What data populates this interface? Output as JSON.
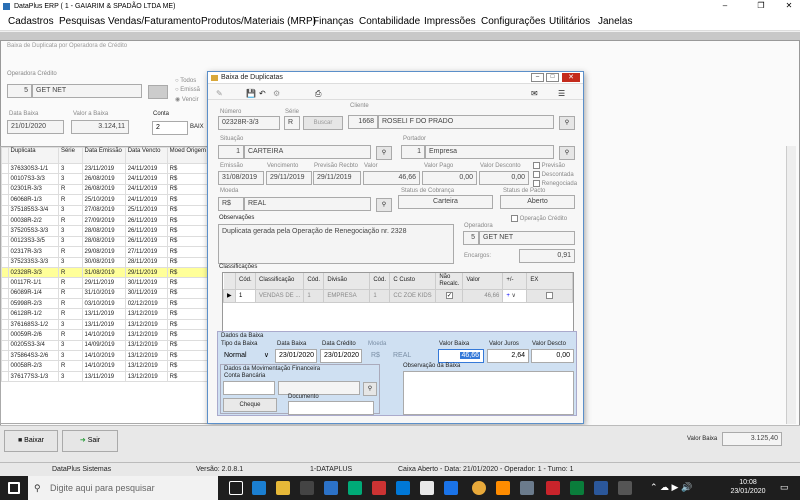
{
  "app": {
    "title": "DataPlus ERP ( 1 - GAIARIM & SPADÃO LTDA ME)"
  },
  "menu": [
    "Cadastros",
    "Pesquisas",
    "Vendas/Faturamento",
    "Produtos/Materiais (MRP)",
    "Finanças",
    "Contabilidade",
    "Impressões",
    "Configurações",
    "Utilitários",
    "Janelas"
  ],
  "bg": {
    "title": "Baixa de Duplicata por Operadora de Crédito",
    "operadora_label": "Operadora Crédito",
    "operadora_code": "5",
    "operadora_name": "GET NET",
    "radio_todos": "Todos",
    "radio_emiss": "Emissã",
    "radio_venci": "Vencir",
    "data_baixa_label": "Data Baixa",
    "data_baixa": "21/01/2020",
    "valor_baixa_label": "Valor a Baixa",
    "valor_baixa": "3.124,11",
    "conta_label": "Conta",
    "conta_value": "2",
    "baix_label": "BAIX",
    "grid_headers": [
      "Duplicata",
      "Série",
      "Data Emissão",
      "Data Vencto",
      "Moed Origem"
    ],
    "rows": [
      [
        "376330S3-1/1",
        "3",
        "23/11/2019",
        "24/11/2019",
        "R$"
      ],
      [
        "00107S3-3/3",
        "3",
        "26/08/2019",
        "24/11/2019",
        "R$"
      ],
      [
        "02301R-3/3",
        "R",
        "26/08/2019",
        "24/11/2019",
        "R$"
      ],
      [
        "06068R-1/3",
        "R",
        "25/10/2019",
        "24/11/2019",
        "R$"
      ],
      [
        "375185S3-3/4",
        "3",
        "27/08/2019",
        "25/11/2019",
        "R$"
      ],
      [
        "00038R-2/2",
        "R",
        "27/09/2019",
        "26/11/2019",
        "R$"
      ],
      [
        "375205S3-3/3",
        "3",
        "28/08/2019",
        "26/11/2019",
        "R$"
      ],
      [
        "00123S3-3/5",
        "3",
        "28/08/2019",
        "26/11/2019",
        "R$"
      ],
      [
        "02317R-3/3",
        "R",
        "29/08/2019",
        "27/11/2019",
        "R$"
      ],
      [
        "375233S3-3/3",
        "3",
        "30/08/2019",
        "28/11/2019",
        "R$"
      ],
      [
        "02328R-3/3",
        "R",
        "31/08/2019",
        "29/11/2019",
        "R$"
      ],
      [
        "00117R-1/1",
        "R",
        "29/11/2019",
        "30/11/2019",
        "R$"
      ],
      [
        "06089R-1/4",
        "R",
        "31/10/2019",
        "30/11/2019",
        "R$"
      ],
      [
        "05998R-2/3",
        "R",
        "03/10/2019",
        "02/12/2019",
        "R$"
      ],
      [
        "06128R-1/2",
        "R",
        "13/11/2019",
        "13/12/2019",
        "R$"
      ],
      [
        "376168S3-1/2",
        "3",
        "13/11/2019",
        "13/12/2019",
        "R$"
      ],
      [
        "00059R-2/6",
        "R",
        "14/10/2019",
        "13/12/2019",
        "R$"
      ],
      [
        "00205S3-3/4",
        "3",
        "14/09/2019",
        "13/12/2019",
        "R$"
      ],
      [
        "375864S3-2/6",
        "3",
        "14/10/2019",
        "13/12/2019",
        "R$"
      ],
      [
        "00058R-2/3",
        "R",
        "14/10/2019",
        "13/12/2019",
        "R$"
      ],
      [
        "376177S3-1/3",
        "3",
        "13/11/2019",
        "13/12/2019",
        "R$"
      ]
    ],
    "baixar_label": "Baixar",
    "sair_label": "Sair",
    "valor_baixa_bottom_label": "Valor Baixa",
    "valor_baixa_bottom": "3.125,40"
  },
  "dlg": {
    "title": "Baixa de Duplicatas",
    "numero_label": "Número",
    "numero": "02328R-3/3",
    "serie_label": "Série",
    "serie": "R",
    "buscar_label": "Buscar",
    "cliente_label": "Cliente",
    "cliente_code": "1668",
    "cliente_name": "ROSELI F DO PRADO",
    "situacao_label": "Situação",
    "situacao_code": "1",
    "situacao_name": "CARTEIRA",
    "portador_label": "Portador",
    "portador_code": "1",
    "portador_name": "Empresa",
    "emissao_label": "Emissão",
    "emissao": "31/08/2019",
    "vencimento_label": "Vencimento",
    "vencimento": "29/11/2019",
    "previsao_label": "Previsão Recbto",
    "previsao": "29/11/2019",
    "valor_label": "Valor",
    "valor": "46,66",
    "valor_pago_label": "Valor Pago",
    "valor_pago": "0,00",
    "valor_desconto_label": "Valor Desconto",
    "valor_desconto": "0,00",
    "chk_previsao": "Previsão",
    "chk_descontada": "Descontada",
    "chk_renegociada": "Renegociada",
    "moeda_label": "Moeda",
    "moeda_code": "R$",
    "moeda_name": "REAL",
    "status_cobranca_label": "Status de Cobrança",
    "status_cobranca": "Carteira",
    "status_pacto_label": "Status de Pacto",
    "status_pacto": "Aberto",
    "observacoes_label": "Observações",
    "observacoes": "Duplicata gerada pela Operação de Renegociação nr. 2328",
    "operacao_credito_label": "Operação Crédito",
    "operadora_label": "Operadora",
    "operadora_code": "5",
    "operadora_name": "GET NET",
    "encargos_label": "Encargos:",
    "encargos": "0,91",
    "classificacoes_label": "Classificações",
    "cls_headers": [
      "Cód.",
      "Classificação",
      "Cód.",
      "Divisão",
      "Cód.",
      "C Custo",
      "Não Recalc.",
      "Valor",
      "+/-",
      "EX"
    ],
    "cls_row": {
      "cod": "1",
      "classificacao": "VENDAS DE ...",
      "cod2": "1",
      "divisao": "EMPRESA",
      "cod3": "1",
      "custo": "CC ZOE KIDS",
      "valor": "46,66",
      "sinal": "+"
    },
    "dados_baixa_label": "Dados da Baixa",
    "tipo_baixa_label": "Tipo da Baixa",
    "tipo_baixa": "Normal",
    "data_baixa_label": "Data Baixa",
    "data_baixa": "23/01/2020",
    "data_credito_label": "Data Crédito",
    "data_credito": "23/01/2020",
    "moeda2_label": "Moeda",
    "moeda2_code": "R$",
    "moeda2_name": "REAL",
    "valor_baixa_label": "Valor Baixa",
    "valor_baixa": "46,66",
    "valor_juros_label": "Valor Juros",
    "valor_juros": "2,64",
    "valor_descto_label": "Valor Descto",
    "valor_descto": "0,00",
    "mov_label": "Dados da Movimentação Financeira",
    "conta_label": "Conta Bancária",
    "documento_label": "Documento",
    "cheque_label": "Cheque",
    "obs_baixa_label": "Observação da Baixa"
  },
  "status": {
    "company": "DataPlus Sistemas",
    "version": "Versão: 2.0.8.1",
    "server": "1-DATAPLUS",
    "caixa": "Caixa Aberto - Data: 21/01/2020 - Operador: 1 - Turno: 1"
  },
  "taskbar": {
    "search": "Digite aqui para pesquisar",
    "time": "10:08",
    "date": "23/01/2020"
  }
}
